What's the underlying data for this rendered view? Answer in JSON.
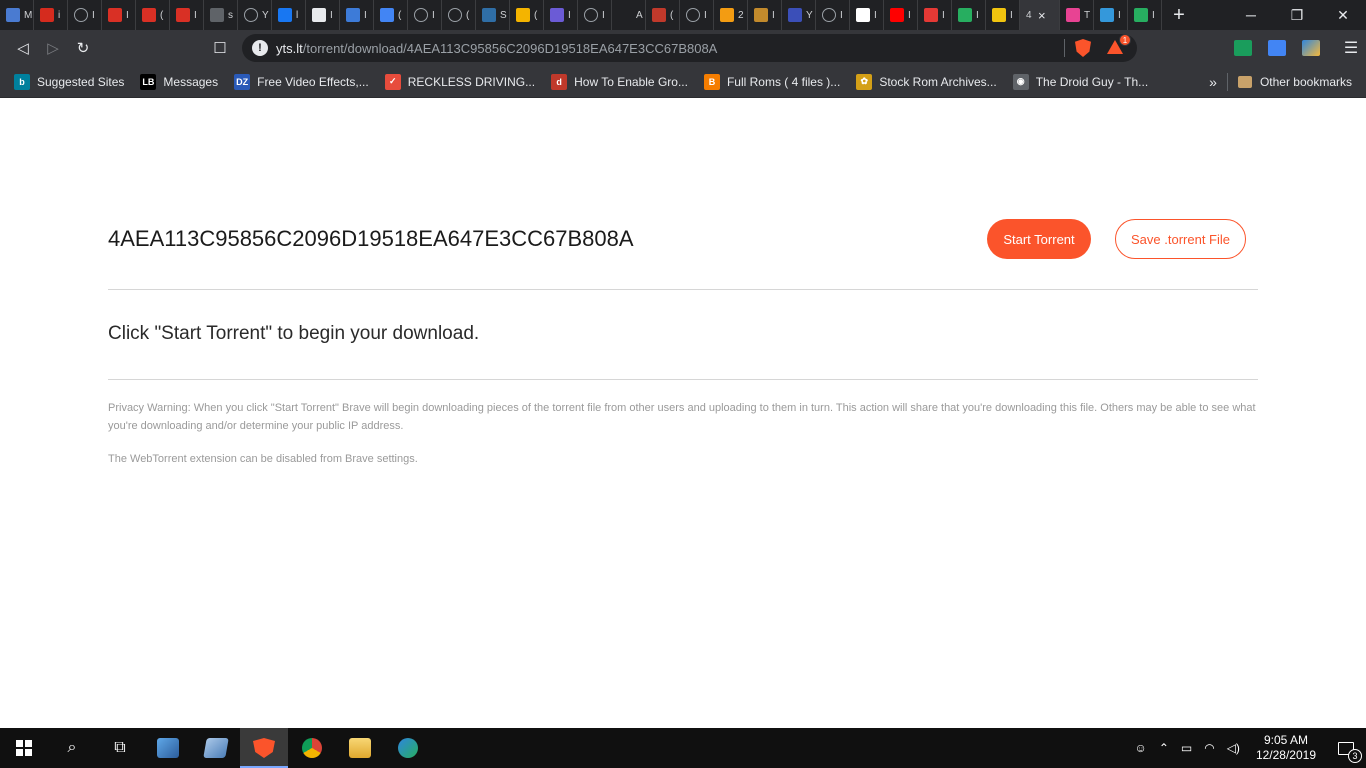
{
  "browser": {
    "tabs": [
      {
        "icon": "mail-icon",
        "color": "#4a7bd1",
        "title": "M"
      },
      {
        "icon": "canada-flag-icon",
        "color": "#d52b1e",
        "title": "i"
      },
      {
        "icon": "globe-icon",
        "color": "",
        "title": "I"
      },
      {
        "icon": "gmail-icon",
        "color": "#d93025",
        "title": "I"
      },
      {
        "icon": "gmail-icon",
        "color": "#d93025",
        "title": "("
      },
      {
        "icon": "gmail-icon",
        "color": "#d93025",
        "title": "I"
      },
      {
        "icon": "loading-icon",
        "color": "#5f6368",
        "title": "s"
      },
      {
        "icon": "globe-icon",
        "color": "",
        "title": "Y"
      },
      {
        "icon": "facebook-icon",
        "color": "#1877f2",
        "title": "l"
      },
      {
        "icon": "hand-icon",
        "color": "#e8eaed",
        "title": "I"
      },
      {
        "icon": "shield-icon",
        "color": "#3d7bd8",
        "title": "I"
      },
      {
        "icon": "translate-icon",
        "color": "#4285f4",
        "title": "("
      },
      {
        "icon": "globe-icon",
        "color": "",
        "title": "I"
      },
      {
        "icon": "globe-icon",
        "color": "",
        "title": "("
      },
      {
        "icon": "chart-icon",
        "color": "#2f6ea6",
        "title": "S"
      },
      {
        "icon": "google-g-icon",
        "color": "#f4b400",
        "title": "("
      },
      {
        "icon": "cube-icon",
        "color": "#6b5bd6",
        "title": "I"
      },
      {
        "icon": "globe-icon",
        "color": "",
        "title": "I"
      },
      {
        "icon": "blank-icon",
        "color": "#202124",
        "title": "A"
      },
      {
        "icon": "law-icon",
        "color": "#c0392b",
        "title": "("
      },
      {
        "icon": "globe-icon",
        "color": "",
        "title": "I"
      },
      {
        "icon": "x-logo-icon",
        "color": "#f39c12",
        "title": "2"
      },
      {
        "icon": "bottle-icon",
        "color": "#c28a2c",
        "title": "I"
      },
      {
        "icon": "sigma-icon",
        "color": "#3b4fb8",
        "title": "Y"
      },
      {
        "icon": "globe-icon",
        "color": "",
        "title": "I"
      },
      {
        "icon": "white-square-icon",
        "color": "#ffffff",
        "title": "I"
      },
      {
        "icon": "youtube-icon",
        "color": "#ff0000",
        "title": "I"
      },
      {
        "icon": "red-x-icon",
        "color": "#e53935",
        "title": "I"
      },
      {
        "icon": "grid-icon",
        "color": "#27ae60",
        "title": "I"
      },
      {
        "icon": "diamond-icon",
        "color": "#f1c40f",
        "title": "I"
      }
    ],
    "active_tab": {
      "title": "4",
      "close": "×"
    },
    "tabs_after": [
      {
        "icon": "tf-icon",
        "color": "#e84393",
        "title": "T"
      },
      {
        "icon": "t-icon",
        "color": "#3498db",
        "title": "I"
      },
      {
        "icon": "grid-icon",
        "color": "#27ae60",
        "title": "I"
      }
    ],
    "new_tab": "+",
    "window": {
      "minimize": "─",
      "restore": "❐",
      "close": "✕"
    },
    "nav": {
      "back": "◁",
      "forward": "▷",
      "reload": "↻",
      "bookmark": "☐"
    },
    "address": {
      "host": "yts.lt",
      "path": "/torrent/download/4AEA113C95856C2096D19518EA647E3CC67B808A",
      "info": "!"
    },
    "rewards_badge": "1",
    "menu": "☰",
    "bookmarks": [
      {
        "label": "Suggested Sites",
        "icon_text": "b",
        "color": "#00809d"
      },
      {
        "label": "Messages",
        "icon_text": "LB",
        "color": "#000000"
      },
      {
        "label": "Free Video Effects,...",
        "icon_text": "DZ",
        "color": "#2a5ab8"
      },
      {
        "label": "RECKLESS DRIVING...",
        "icon_text": "✓",
        "color": "#e74c3c"
      },
      {
        "label": "How To Enable Gro...",
        "icon_text": "d",
        "color": "#c0392b"
      },
      {
        "label": "Full Roms ( 4 files )...",
        "icon_text": "B",
        "color": "#f57d00"
      },
      {
        "label": "Stock Rom Archives...",
        "icon_text": "✿",
        "color": "#d4a017"
      },
      {
        "label": "The Droid Guy - Th...",
        "icon_text": "◉",
        "color": "#5f6368"
      }
    ],
    "bookmarks_overflow": "»",
    "other_bookmarks": "Other bookmarks"
  },
  "page": {
    "hash": "4AEA113C95856C2096D19518EA647E3CC67B808A",
    "start_button": "Start Torrent",
    "save_button": "Save .torrent File",
    "instruction": "Click \"Start Torrent\" to begin your download.",
    "privacy_warning": "Privacy Warning: When you click \"Start Torrent\" Brave will begin downloading pieces of the torrent file from other users and uploading to them in turn. This action will share that you're downloading this file. Others may be able to see what you're downloading and/or determine your public IP address.",
    "disable_note": "The WebTorrent extension can be disabled from Brave settings.",
    "accent_color": "#fb542b"
  },
  "taskbar": {
    "search": "⌕",
    "taskview": "⧉",
    "clock_time": "9:05 AM",
    "clock_date": "12/28/2019",
    "notifications_count": "3"
  }
}
